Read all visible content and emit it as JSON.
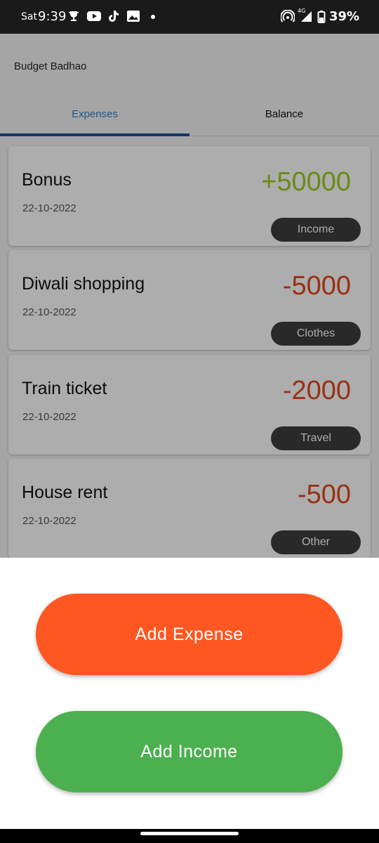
{
  "status_bar": {
    "day": "Sat",
    "time": "9:39",
    "network_label": "4G",
    "battery": "39%",
    "icons": [
      "trophy-icon",
      "youtube-icon",
      "tiktok-icon",
      "gallery-icon",
      "dot-icon",
      "hotspot-icon",
      "signal-icon",
      "battery-icon"
    ]
  },
  "app": {
    "title": "Budget Badhao"
  },
  "tabs": [
    {
      "label": "Expenses",
      "active": true
    },
    {
      "label": "Balance",
      "active": false
    }
  ],
  "transactions": [
    {
      "title": "Bonus",
      "date": "22-10-2022",
      "amount": "+50000",
      "category": "Income",
      "type": "income"
    },
    {
      "title": "Diwali shopping",
      "date": "22-10-2022",
      "amount": "-5000",
      "category": "Clothes",
      "type": "expense"
    },
    {
      "title": "Train ticket",
      "date": "22-10-2022",
      "amount": "-2000",
      "category": "Travel",
      "type": "expense"
    },
    {
      "title": "House rent",
      "date": "22-10-2022",
      "amount": "-500",
      "category": "Other",
      "type": "expense"
    }
  ],
  "sheet": {
    "add_expense_label": "Add Expense",
    "add_income_label": "Add Income"
  },
  "colors": {
    "tab_active": "#2a7fc9",
    "tab_indicator": "#1d4fa3",
    "income_amount": "#9ccc1e",
    "expense_amount": "#e0481e",
    "add_expense_button": "#fe5722",
    "add_income_button": "#4cb050"
  }
}
